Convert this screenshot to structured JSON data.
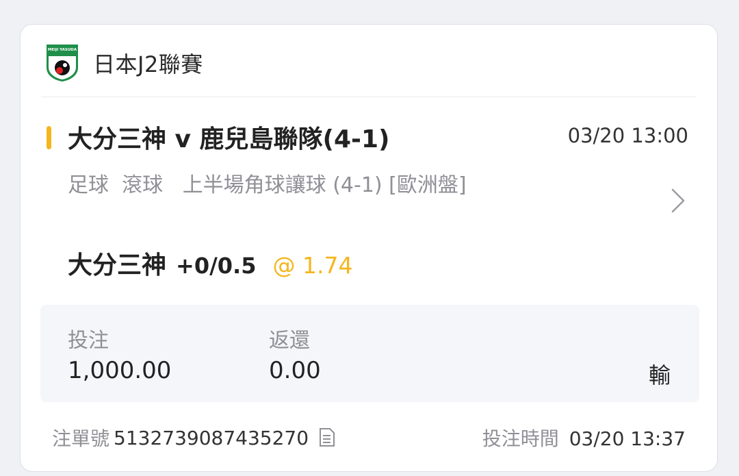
{
  "league": {
    "name": "日本J2聯賽",
    "logo_icon": "j-league-logo-icon",
    "logo_text": "MEIJI YASUDA"
  },
  "match": {
    "title": "大分三神 v 鹿兒島聯隊(4-1)",
    "datetime": "03/20 13:00",
    "accent_color": "#f5b51d"
  },
  "market": {
    "sport": "足球",
    "mode": "滾球",
    "description": "上半場角球讓球 (4-1) [歐洲盤]"
  },
  "selection": {
    "team": "大分三神",
    "line": "+0/0.5",
    "odds": "@ 1.74"
  },
  "stake": {
    "bet_label": "投注",
    "bet_value": "1,000.00",
    "return_label": "返還",
    "return_value": "0.00",
    "result": "輸"
  },
  "footer": {
    "ticket_label": "注單號",
    "ticket_number": "5132739087435270",
    "bet_time_label": "投注時間",
    "bet_time_value": "03/20 13:37"
  }
}
